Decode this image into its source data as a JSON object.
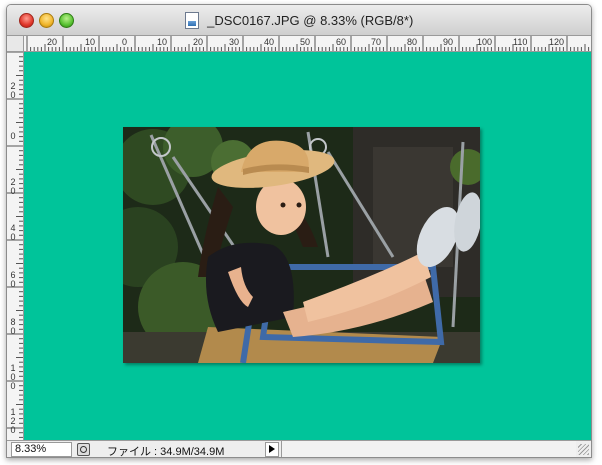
{
  "window": {
    "title": "_DSC0167.JPG @ 8.33% (RGB/8*)",
    "canvas_color": "#00c49a"
  },
  "rulers": {
    "top_labels": [
      "20",
      "10",
      "0",
      "10",
      "20",
      "30",
      "40",
      "50",
      "60",
      "70",
      "80",
      "90",
      "100",
      "110",
      "120"
    ],
    "left_labels": [
      "2 0",
      "0",
      "2 0",
      "4 0",
      "6 0",
      "8 0",
      "1 0 0",
      "1 2 0"
    ]
  },
  "status": {
    "zoom": "8.33%",
    "file_info": "ファイル : 34.9M/34.9M"
  },
  "icons": [
    "close-button",
    "minimize-button",
    "zoom-button",
    "document-icon",
    "status-info-icon",
    "status-menu-arrow",
    "resize-grip"
  ]
}
